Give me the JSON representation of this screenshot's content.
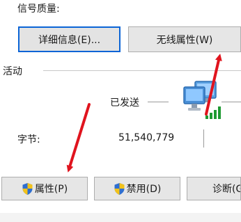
{
  "connection": {
    "signal_quality_label": "信号质量:",
    "details_button": "详细信息(E)...",
    "wireless_properties_button": "无线属性(W)"
  },
  "activity": {
    "section_label": "活动",
    "sent_label": "已发送",
    "bytes_label": "字节:",
    "bytes_sent_value": "51,540,779"
  },
  "actions": {
    "properties_button": "属性(P)",
    "disable_button": "禁用(D)",
    "diagnose_button": "诊断(G"
  },
  "annotations": {
    "arrow_color": "#e0141e"
  },
  "icons": {
    "admin_shield": "uac-shield-icon",
    "network_activity": "network-computers-icon",
    "signal": "signal-bars-icon"
  }
}
